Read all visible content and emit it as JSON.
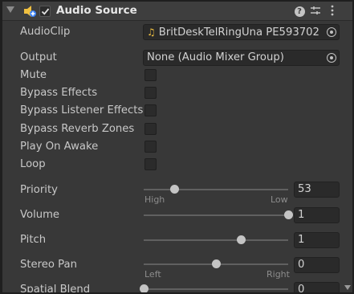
{
  "header": {
    "title": "Audio Source",
    "enabled": true,
    "icons": [
      "foldout-arrow",
      "audio-source-icon",
      "enabled-checkbox",
      "help-icon",
      "presets-icon",
      "kebab-menu-icon"
    ]
  },
  "fields": {
    "audioclip": {
      "label": "AudioClip",
      "value": "BritDeskTelRingUna PE593702",
      "icon": "audio-clip-icon"
    },
    "output": {
      "label": "Output",
      "value": "None (Audio Mixer Group)"
    }
  },
  "toggles": [
    {
      "label": "Mute",
      "checked": false
    },
    {
      "label": "Bypass Effects",
      "checked": false
    },
    {
      "label": "Bypass Listener Effects",
      "checked": false
    },
    {
      "label": "Bypass Reverb Zones",
      "checked": false
    },
    {
      "label": "Play On Awake",
      "checked": false
    },
    {
      "label": "Loop",
      "checked": false
    }
  ],
  "sliders": {
    "priority": {
      "label": "Priority",
      "value": "53",
      "level": 0.21,
      "min_caption": "High",
      "max_caption": "Low"
    },
    "volume": {
      "label": "Volume",
      "value": "1",
      "level": 1.0
    },
    "pitch": {
      "label": "Pitch",
      "value": "1",
      "level": 0.67
    },
    "stereo_pan": {
      "label": "Stereo Pan",
      "value": "0",
      "level": 0.5,
      "min_caption": "Left",
      "max_caption": "Right"
    },
    "spatial_blend": {
      "label": "Spatial Blend",
      "value": "0",
      "level": 0.0
    }
  },
  "colors": {
    "background": "#383838",
    "field": "#2a2a2a",
    "text": "#c8c8c8",
    "accent_icon": "#f0c040"
  }
}
